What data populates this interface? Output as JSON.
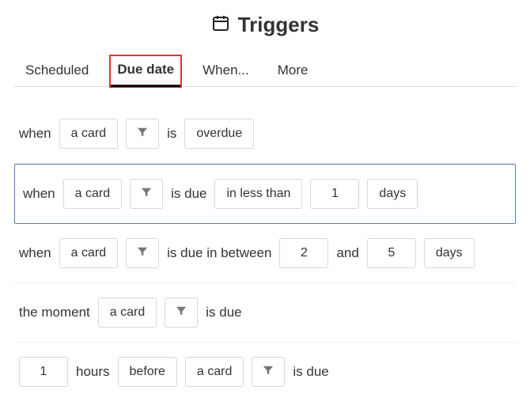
{
  "title": "Triggers",
  "tabs": [
    {
      "label": "Scheduled",
      "active": false
    },
    {
      "label": "Due date",
      "active": true,
      "highlighted": true
    },
    {
      "label": "When...",
      "active": false
    },
    {
      "label": "More",
      "active": false
    }
  ],
  "words": {
    "when": "when",
    "the_moment": "the moment",
    "is": "is",
    "is_due": "is due",
    "is_due_in_between": "is due in between",
    "and": "and",
    "a_card": "a card",
    "overdue": "overdue",
    "in_less_than": "in less than",
    "days": "days",
    "hours": "hours",
    "before": "before"
  },
  "rules": [
    {
      "value1": "",
      "value2": ""
    },
    {
      "value1": "1",
      "value2": ""
    },
    {
      "value1": "2",
      "value2": "5"
    },
    {
      "value1": "",
      "value2": ""
    },
    {
      "value1": "1",
      "value2": ""
    }
  ],
  "icons": {
    "calendar": "calendar-icon",
    "filter": "filter-icon"
  }
}
